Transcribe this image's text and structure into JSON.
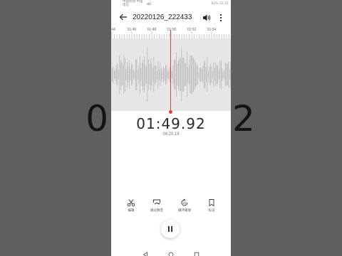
{
  "background_time": "01:49.92",
  "statusbar": {
    "carrier": "中国移动 中国电信",
    "signal": "all",
    "battery": "82%",
    "time": "22:31"
  },
  "appbar": {
    "title": "20220126_222433",
    "icons": [
      "back-arrow-icon",
      "volume-icon",
      "more-vertical-icon"
    ]
  },
  "timeline": {
    "ticks": [
      "44",
      "01:46",
      "01:48",
      "01:50",
      "01:52",
      "01:54"
    ]
  },
  "playback": {
    "current_time": "01:49.92",
    "total_time": "04:20.18"
  },
  "toolbar": {
    "edit_label": "编辑",
    "skip_silence_label": "跳过静音",
    "loop_label": "循环播放",
    "mark_label": "标记"
  },
  "colors": {
    "accent_red": "#e0423c",
    "waveform": "#b0b0b0",
    "waveform_bg": "#e6e6e6"
  },
  "navbar": {
    "icons": [
      "back-triangle-icon",
      "home-circle-icon",
      "recents-square-icon"
    ]
  }
}
